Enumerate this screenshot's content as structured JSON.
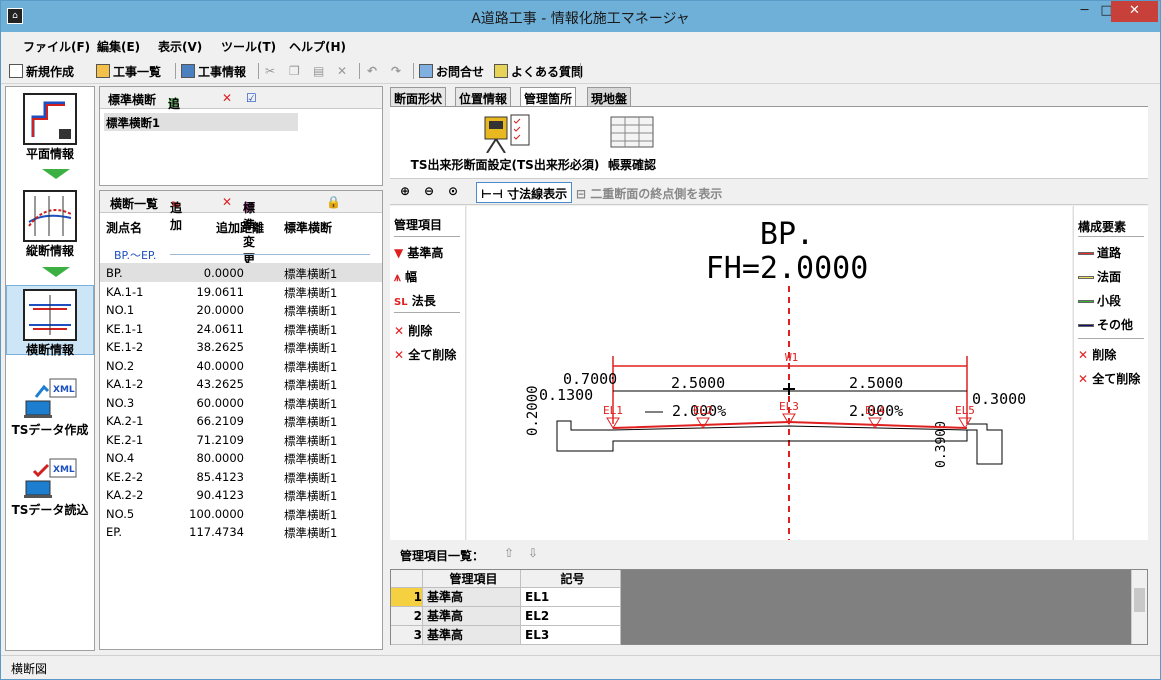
{
  "window": {
    "title": "A道路工事 - 情報化施工マネージャ",
    "app_icon": "app-logo-icon"
  },
  "menu": [
    "ファイル(F)",
    "編集(E)",
    "表示(V)",
    "ツール(T)",
    "ヘルプ(H)"
  ],
  "toolbar": {
    "new_project": "新規作成",
    "project_list": "工事一覧",
    "project_info": "工事情報",
    "contact": "お問合せ",
    "faq": "よくある質問"
  },
  "nav": {
    "plan": "平面情報",
    "profile": "縦断情報",
    "cross": "横断情報",
    "ts_create": "TSデータ作成",
    "ts_read": "TSデータ読込",
    "xml_label": "XML"
  },
  "standard_cross": {
    "title": "標準横断",
    "add": "追加",
    "items": [
      "標準横断1"
    ]
  },
  "cross_list": {
    "title": "横断一覧",
    "add": "追加",
    "change_std": "標準変更",
    "headers": [
      "測点名",
      "追加距離",
      "標準横断"
    ],
    "section": "BP.～EP.",
    "rows": [
      [
        "BP.",
        "0.0000",
        "標準横断1"
      ],
      [
        "KA.1-1",
        "19.0611",
        "標準横断1"
      ],
      [
        "NO.1",
        "20.0000",
        "標準横断1"
      ],
      [
        "KE.1-1",
        "24.0611",
        "標準横断1"
      ],
      [
        "KE.1-2",
        "38.2625",
        "標準横断1"
      ],
      [
        "NO.2",
        "40.0000",
        "標準横断1"
      ],
      [
        "KA.1-2",
        "43.2625",
        "標準横断1"
      ],
      [
        "NO.3",
        "60.0000",
        "標準横断1"
      ],
      [
        "KA.2-1",
        "66.2109",
        "標準横断1"
      ],
      [
        "KE.2-1",
        "71.2109",
        "標準横断1"
      ],
      [
        "NO.4",
        "80.0000",
        "標準横断1"
      ],
      [
        "KE.2-2",
        "85.4123",
        "標準横断1"
      ],
      [
        "KA.2-2",
        "90.4123",
        "標準横断1"
      ],
      [
        "NO.5",
        "100.0000",
        "標準横断1"
      ],
      [
        "EP.",
        "117.4734",
        "標準横断1"
      ]
    ]
  },
  "tabs": [
    "断面形状",
    "位置情報",
    "管理箇所",
    "現地盤"
  ],
  "active_tab": "管理箇所",
  "ribbon": {
    "ts_setting": "TS出来形断面設定(TS出来形必須)",
    "report": "帳票確認"
  },
  "view_toolbar": {
    "dim_display": "寸法線表示",
    "double_section": "二重断面の終点側を表示"
  },
  "mgmt": {
    "title": "管理項目",
    "items": [
      "基準高",
      "幅",
      "法長",
      "削除",
      "全て削除"
    ]
  },
  "drawing": {
    "station": "BP.",
    "fh": "FH=2.0000",
    "w1": "W1",
    "d1": "2.5000",
    "d2": "2.5000",
    "s1": "2.000%",
    "s2": "2.000%",
    "l07": "0.7000",
    "l01": "0.1300",
    "l02": "0.2000",
    "l03": "0.3000",
    "l04": "0.3900",
    "pts": [
      "EL1",
      "EL2",
      "EL3",
      "EL4",
      "EL5"
    ]
  },
  "legend": {
    "title": "構成要素",
    "items": [
      {
        "label": "道路",
        "color": "#e53030"
      },
      {
        "label": "法面",
        "color": "#f0e060"
      },
      {
        "label": "小段",
        "color": "#38b038"
      },
      {
        "label": "その他",
        "color": "#10106a"
      }
    ],
    "del": "削除",
    "del_all": "全て削除"
  },
  "mgmt_grid": {
    "title": "管理項目一覧：",
    "headers": [
      "管理項目",
      "記号"
    ],
    "rows": [
      [
        "1",
        "基準高",
        "EL1"
      ],
      [
        "2",
        "基準高",
        "EL2"
      ],
      [
        "3",
        "基準高",
        "EL3"
      ]
    ]
  },
  "status": {
    "text": "横断図"
  }
}
